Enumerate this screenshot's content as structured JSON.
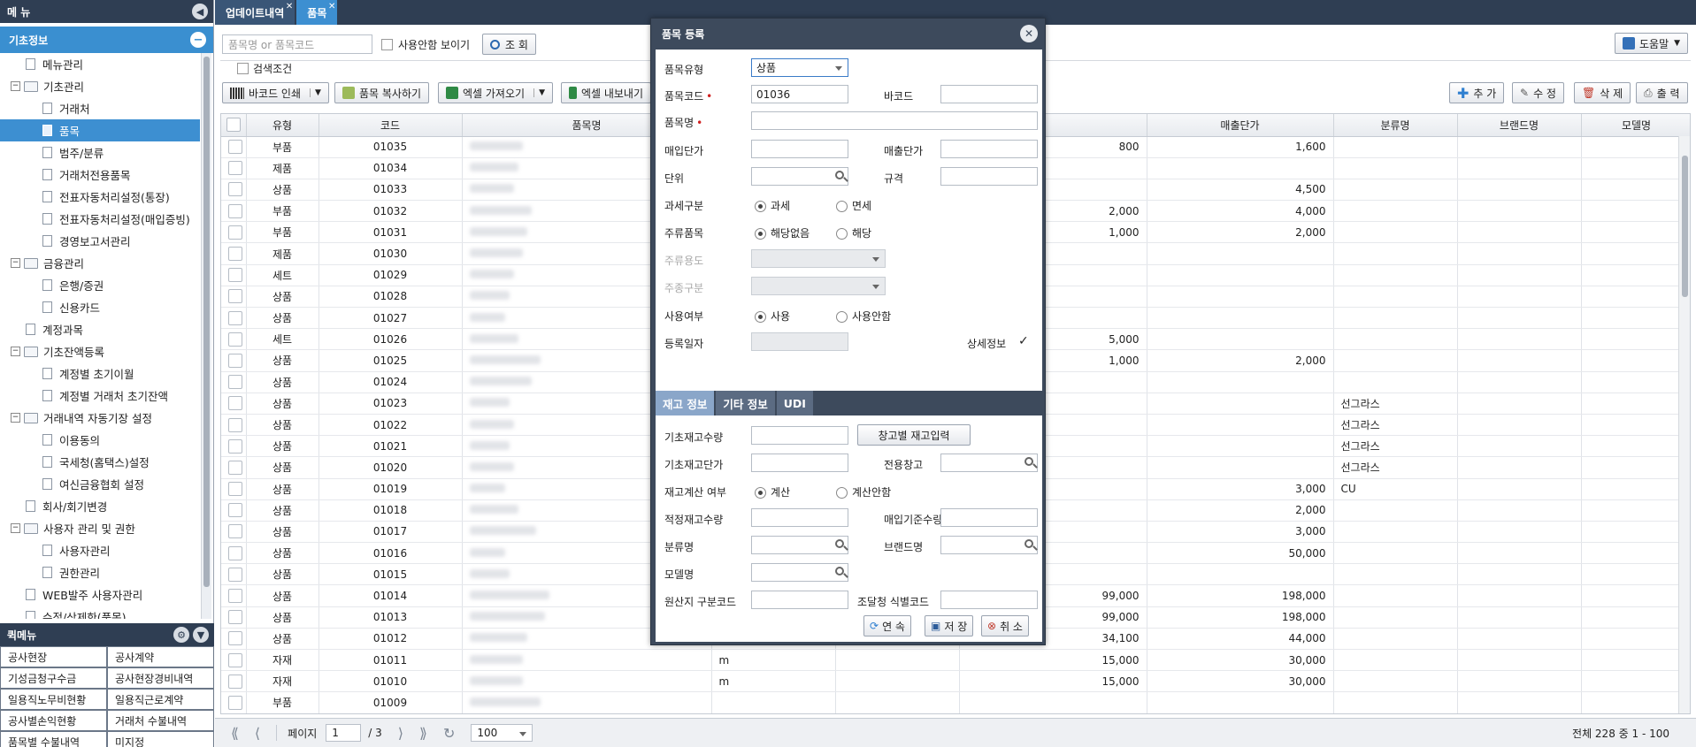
{
  "sidebar": {
    "title": "메 뉴",
    "section": "기초정보",
    "tree": [
      {
        "level": 1,
        "type": "doc",
        "label": "메뉴관리"
      },
      {
        "level": 0,
        "type": "folder",
        "label": "기초관리"
      },
      {
        "level": 2,
        "type": "doc",
        "label": "거래처"
      },
      {
        "level": 2,
        "type": "doc",
        "label": "품목",
        "selected": true
      },
      {
        "level": 2,
        "type": "doc",
        "label": "범주/분류"
      },
      {
        "level": 2,
        "type": "doc",
        "label": "거래처전용품목"
      },
      {
        "level": 2,
        "type": "doc",
        "label": "전표자동처리설정(통장)"
      },
      {
        "level": 2,
        "type": "doc",
        "label": "전표자동처리설정(매입증빙)"
      },
      {
        "level": 2,
        "type": "doc",
        "label": "경영보고서관리"
      },
      {
        "level": 0,
        "type": "folder",
        "label": "금융관리"
      },
      {
        "level": 2,
        "type": "doc",
        "label": "은행/증권"
      },
      {
        "level": 2,
        "type": "doc",
        "label": "신용카드"
      },
      {
        "level": 1,
        "type": "doc",
        "label": "계정과목"
      },
      {
        "level": 0,
        "type": "folder",
        "label": "기초잔액등록"
      },
      {
        "level": 2,
        "type": "doc",
        "label": "계정별 초기이월"
      },
      {
        "level": 2,
        "type": "doc",
        "label": "계정별 거래처 초기잔액"
      },
      {
        "level": 0,
        "type": "folder",
        "label": "거래내역 자동기장 설정"
      },
      {
        "level": 2,
        "type": "doc",
        "label": "이용동의"
      },
      {
        "level": 2,
        "type": "doc",
        "label": "국세청(홈택스)설정"
      },
      {
        "level": 2,
        "type": "doc",
        "label": "여신금융협회 설정"
      },
      {
        "level": 1,
        "type": "doc",
        "label": "회사/회기변경"
      },
      {
        "level": 0,
        "type": "folder",
        "label": "사용자 관리 및 권한"
      },
      {
        "level": 2,
        "type": "doc",
        "label": "사용자관리"
      },
      {
        "level": 2,
        "type": "doc",
        "label": "권한관리"
      },
      {
        "level": 1,
        "type": "doc",
        "label": "WEB발주 사용자관리"
      },
      {
        "level": 1,
        "type": "doc",
        "label": "수정/삭제한(품목)"
      }
    ],
    "quick_title": "퀵메뉴",
    "quick_items": [
      "공사현장",
      "공사계약",
      "기성금청구수금",
      "공사현장경비내역",
      "일용직노무비현황",
      "일용직근로계약",
      "공사별손익현황",
      "거래처 수불내역",
      "품목별 수불내역",
      "미지정"
    ]
  },
  "tabs": [
    {
      "label": "업데이트내역",
      "active": false
    },
    {
      "label": "품목",
      "active": true
    }
  ],
  "toolbar": {
    "search_placeholder": "품목명 or 품목코드",
    "show_unused": "사용안함 보이기",
    "search_btn": "조 회",
    "help_btn": "도움말",
    "filter_label": "검색조건",
    "barcode_btn": "바코드 인쇄",
    "copy_btn": "품목 복사하기",
    "excel_in_btn": "엑셀 가져오기",
    "excel_out_btn": "엑셀 내보내기",
    "add_btn": "추 가",
    "edit_btn": "수 정",
    "delete_btn": "삭 제",
    "print_btn": "출 력"
  },
  "grid": {
    "columns": [
      "유형",
      "코드",
      "품목명",
      "",
      "",
      "",
      "매출단가",
      "분류명",
      "브랜드명",
      "모델명"
    ],
    "rows": [
      {
        "type": "부품",
        "code": "01035",
        "unit": "",
        "buy": "800",
        "sell": "1,600",
        "cat": ""
      },
      {
        "type": "제품",
        "code": "01034",
        "unit": "",
        "buy": "",
        "sell": "",
        "cat": ""
      },
      {
        "type": "상품",
        "code": "01033",
        "unit": "",
        "buy": "",
        "sell": "4,500",
        "cat": ""
      },
      {
        "type": "부품",
        "code": "01032",
        "unit": "",
        "buy": "2,000",
        "sell": "4,000",
        "cat": ""
      },
      {
        "type": "부품",
        "code": "01031",
        "unit": "",
        "buy": "1,000",
        "sell": "2,000",
        "cat": ""
      },
      {
        "type": "제품",
        "code": "01030",
        "unit": "",
        "buy": "",
        "sell": "",
        "cat": ""
      },
      {
        "type": "세트",
        "code": "01029",
        "unit": "",
        "buy": "",
        "sell": "",
        "cat": ""
      },
      {
        "type": "상품",
        "code": "01028",
        "unit": "",
        "buy": "",
        "sell": "",
        "cat": ""
      },
      {
        "type": "상품",
        "code": "01027",
        "unit": "",
        "buy": "",
        "sell": "",
        "cat": ""
      },
      {
        "type": "세트",
        "code": "01026",
        "unit": "",
        "buy": "5,000",
        "sell": "",
        "cat": ""
      },
      {
        "type": "상품",
        "code": "01025",
        "unit": "",
        "buy": "1,000",
        "sell": "2,000",
        "cat": ""
      },
      {
        "type": "상품",
        "code": "01024",
        "unit": "",
        "buy": "",
        "sell": "",
        "cat": ""
      },
      {
        "type": "상품",
        "code": "01023",
        "unit": "",
        "buy": "",
        "sell": "",
        "cat": "선그라스"
      },
      {
        "type": "상품",
        "code": "01022",
        "unit": "",
        "buy": "",
        "sell": "",
        "cat": "선그라스"
      },
      {
        "type": "상품",
        "code": "01021",
        "unit": "",
        "buy": "",
        "sell": "",
        "cat": "선그라스"
      },
      {
        "type": "상품",
        "code": "01020",
        "unit": "",
        "buy": "",
        "sell": "",
        "cat": "선그라스"
      },
      {
        "type": "상품",
        "code": "01019",
        "unit": "",
        "buy": "",
        "sell": "3,000",
        "cat": "CU"
      },
      {
        "type": "상품",
        "code": "01018",
        "unit": "",
        "buy": "",
        "sell": "2,000",
        "cat": ""
      },
      {
        "type": "상품",
        "code": "01017",
        "unit": "",
        "buy": "",
        "sell": "3,000",
        "cat": ""
      },
      {
        "type": "상품",
        "code": "01016",
        "unit": "",
        "buy": "",
        "sell": "50,000",
        "cat": ""
      },
      {
        "type": "상품",
        "code": "01015",
        "unit": "",
        "buy": "",
        "sell": "",
        "cat": ""
      },
      {
        "type": "상품",
        "code": "01014",
        "unit": "",
        "buy": "99,000",
        "sell": "198,000",
        "cat": ""
      },
      {
        "type": "상품",
        "code": "01013",
        "unit": "",
        "buy": "99,000",
        "sell": "198,000",
        "cat": ""
      },
      {
        "type": "상품",
        "code": "01012",
        "unit": "",
        "buy": "34,100",
        "sell": "44,000",
        "cat": ""
      },
      {
        "type": "자재",
        "code": "01011",
        "unit": "m",
        "buy": "15,000",
        "sell": "30,000",
        "cat": ""
      },
      {
        "type": "자재",
        "code": "01010",
        "unit": "m",
        "buy": "15,000",
        "sell": "30,000",
        "cat": ""
      },
      {
        "type": "부품",
        "code": "01009",
        "unit": "",
        "buy": "",
        "sell": "",
        "cat": ""
      }
    ]
  },
  "pager": {
    "label": "페이지",
    "page": "1",
    "total_pages": "/ 3",
    "page_size": "100",
    "summary": "전체 228 중 1 - 100"
  },
  "modal": {
    "title": "품목 등록",
    "item_type_label": "품목유형",
    "item_type_value": "상품",
    "code_label": "품목코드",
    "code_value": "01036",
    "barcode_label": "바코드",
    "name_label": "품목명",
    "buy_price_label": "매입단가",
    "sell_price_label": "매출단가",
    "unit_label": "단위",
    "spec_label": "규격",
    "tax_label": "과세구분",
    "tax_on": "과세",
    "tax_free": "면세",
    "liquor_label": "주류품목",
    "liquor_none": "해당없음",
    "liquor_yes": "해당",
    "liquor_use_label": "주류용도",
    "liquor_kind_label": "주종구분",
    "use_label": "사용여부",
    "use_yes": "사용",
    "use_no": "사용안함",
    "reg_date_label": "등록일자",
    "detail_label": "상세정보",
    "tabs": [
      "재고 정보",
      "기타 정보",
      "UDI"
    ],
    "stock_qty_label": "기초재고수량",
    "warehouse_btn": "창고별 재고입력",
    "stock_price_label": "기초재고단가",
    "dedicated_wh_label": "전용창고",
    "stock_calc_label": "재고계산 여부",
    "calc_yes": "계산",
    "calc_no": "계산안함",
    "proper_stock_label": "적정재고수량",
    "buy_base_label": "매입기준수량",
    "category_label": "분류명",
    "brand_label": "브랜드명",
    "model_label": "모델명",
    "origin_label": "원산지 구분코드",
    "procure_label": "조달청 식별코드",
    "continue_btn": "연 속",
    "save_btn": "저 장",
    "cancel_btn": "취 소"
  }
}
